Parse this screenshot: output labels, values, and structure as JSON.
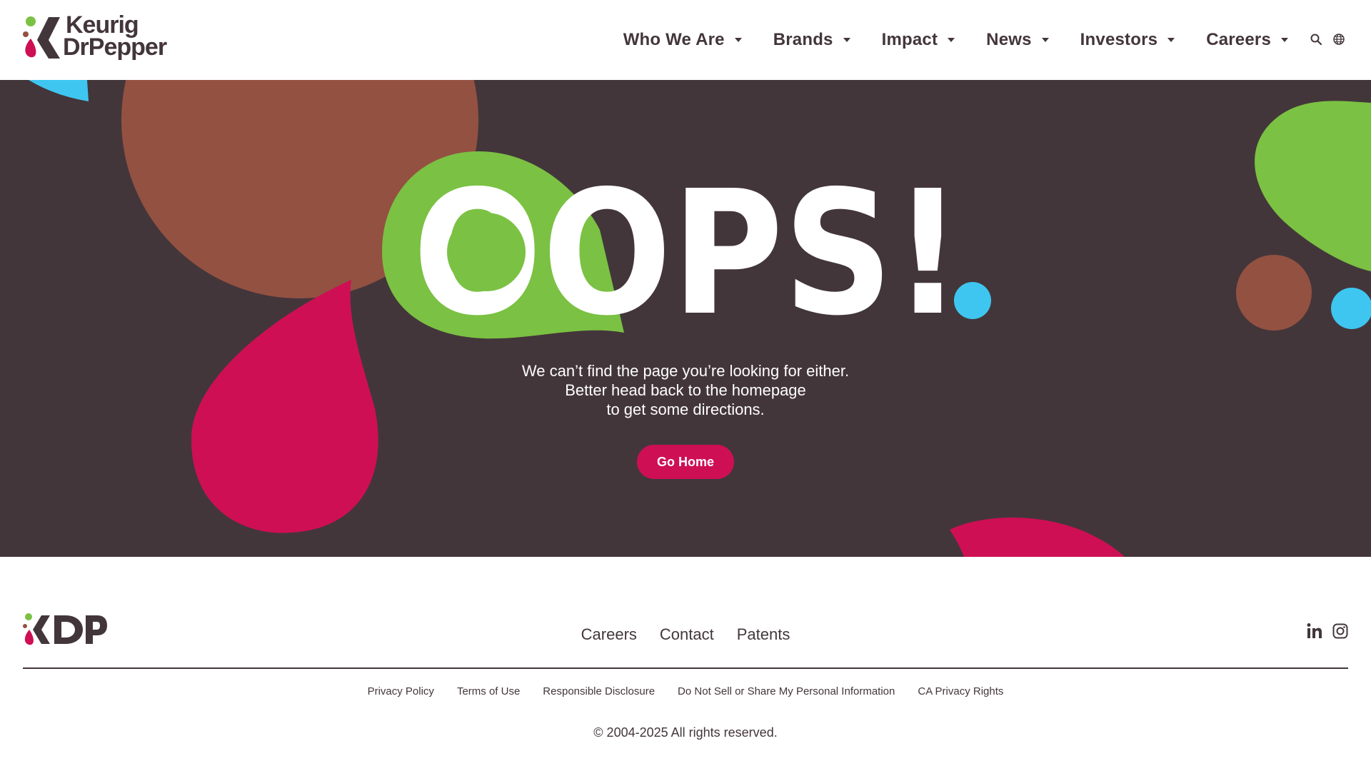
{
  "header": {
    "logo_line1": "Keurig",
    "logo_line2": "DrPepper",
    "nav": [
      {
        "label": "Who We Are"
      },
      {
        "label": "Brands"
      },
      {
        "label": "Impact"
      },
      {
        "label": "News"
      },
      {
        "label": "Investors"
      },
      {
        "label": "Careers"
      }
    ],
    "icons": [
      "search-icon",
      "globe-icon"
    ]
  },
  "hero": {
    "headline": "OOPS!",
    "message_line1": "We can’t find the page you’re looking for either.",
    "message_line2": "Better head back to the homepage",
    "message_line3": "to get some directions.",
    "button_label": "Go Home"
  },
  "footer": {
    "logo_text": "KDP",
    "links": [
      {
        "label": "Careers"
      },
      {
        "label": "Contact"
      },
      {
        "label": "Patents"
      }
    ],
    "social": [
      "linkedin-icon",
      "instagram-icon"
    ],
    "legal": [
      {
        "label": "Privacy Policy"
      },
      {
        "label": "Terms of Use"
      },
      {
        "label": "Responsible Disclosure"
      },
      {
        "label": "Do Not Sell or Share My Personal Information"
      },
      {
        "label": "CA Privacy Rights"
      }
    ],
    "copyright": "© 2004-2025 All rights reserved."
  },
  "colors": {
    "brand_dark": "#43363a",
    "berry": "#ce0f54",
    "green": "#7bc143",
    "brown": "#935142",
    "blue": "#3ec6f0"
  }
}
